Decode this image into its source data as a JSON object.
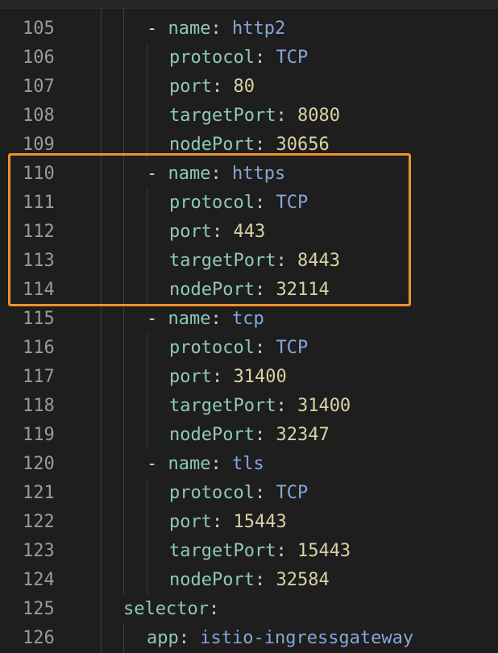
{
  "colors": {
    "background": "#1e1e1e",
    "line_number": "#9a9a9a",
    "key": "#8ec9b6",
    "string_value": "#86a7d8",
    "number_value": "#d8d2a4",
    "punctuation": "#cfcfcf",
    "highlight_border": "#f0912e"
  },
  "lines": [
    {
      "num": "105",
      "dash": "- ",
      "key": "name",
      "colon": ": ",
      "value": "http2",
      "type": "string"
    },
    {
      "num": "106",
      "dash": "",
      "key": "protocol",
      "colon": ": ",
      "value": "TCP",
      "type": "string"
    },
    {
      "num": "107",
      "dash": "",
      "key": "port",
      "colon": ": ",
      "value": "80",
      "type": "number"
    },
    {
      "num": "108",
      "dash": "",
      "key": "targetPort",
      "colon": ": ",
      "value": "8080",
      "type": "number"
    },
    {
      "num": "109",
      "dash": "",
      "key": "nodePort",
      "colon": ": ",
      "value": "30656",
      "type": "number"
    },
    {
      "num": "110",
      "dash": "- ",
      "key": "name",
      "colon": ": ",
      "value": "https",
      "type": "string"
    },
    {
      "num": "111",
      "dash": "",
      "key": "protocol",
      "colon": ": ",
      "value": "TCP",
      "type": "string"
    },
    {
      "num": "112",
      "dash": "",
      "key": "port",
      "colon": ": ",
      "value": "443",
      "type": "number"
    },
    {
      "num": "113",
      "dash": "",
      "key": "targetPort",
      "colon": ": ",
      "value": "8443",
      "type": "number"
    },
    {
      "num": "114",
      "dash": "",
      "key": "nodePort",
      "colon": ": ",
      "value": "32114",
      "type": "number"
    },
    {
      "num": "115",
      "dash": "- ",
      "key": "name",
      "colon": ": ",
      "value": "tcp",
      "type": "string"
    },
    {
      "num": "116",
      "dash": "",
      "key": "protocol",
      "colon": ": ",
      "value": "TCP",
      "type": "string"
    },
    {
      "num": "117",
      "dash": "",
      "key": "port",
      "colon": ": ",
      "value": "31400",
      "type": "number"
    },
    {
      "num": "118",
      "dash": "",
      "key": "targetPort",
      "colon": ": ",
      "value": "31400",
      "type": "number"
    },
    {
      "num": "119",
      "dash": "",
      "key": "nodePort",
      "colon": ": ",
      "value": "32347",
      "type": "number"
    },
    {
      "num": "120",
      "dash": "- ",
      "key": "name",
      "colon": ": ",
      "value": "tls",
      "type": "string"
    },
    {
      "num": "121",
      "dash": "",
      "key": "protocol",
      "colon": ": ",
      "value": "TCP",
      "type": "string"
    },
    {
      "num": "122",
      "dash": "",
      "key": "port",
      "colon": ": ",
      "value": "15443",
      "type": "number"
    },
    {
      "num": "123",
      "dash": "",
      "key": "targetPort",
      "colon": ": ",
      "value": "15443",
      "type": "number"
    },
    {
      "num": "124",
      "dash": "",
      "key": "nodePort",
      "colon": ": ",
      "value": "32584",
      "type": "number"
    },
    {
      "num": "125",
      "dash": "",
      "key": "selector",
      "colon": ":",
      "value": "",
      "type": "string"
    },
    {
      "num": "126",
      "dash": "",
      "key": "app",
      "colon": ": ",
      "value": "istio-ingressgateway",
      "type": "string"
    }
  ]
}
